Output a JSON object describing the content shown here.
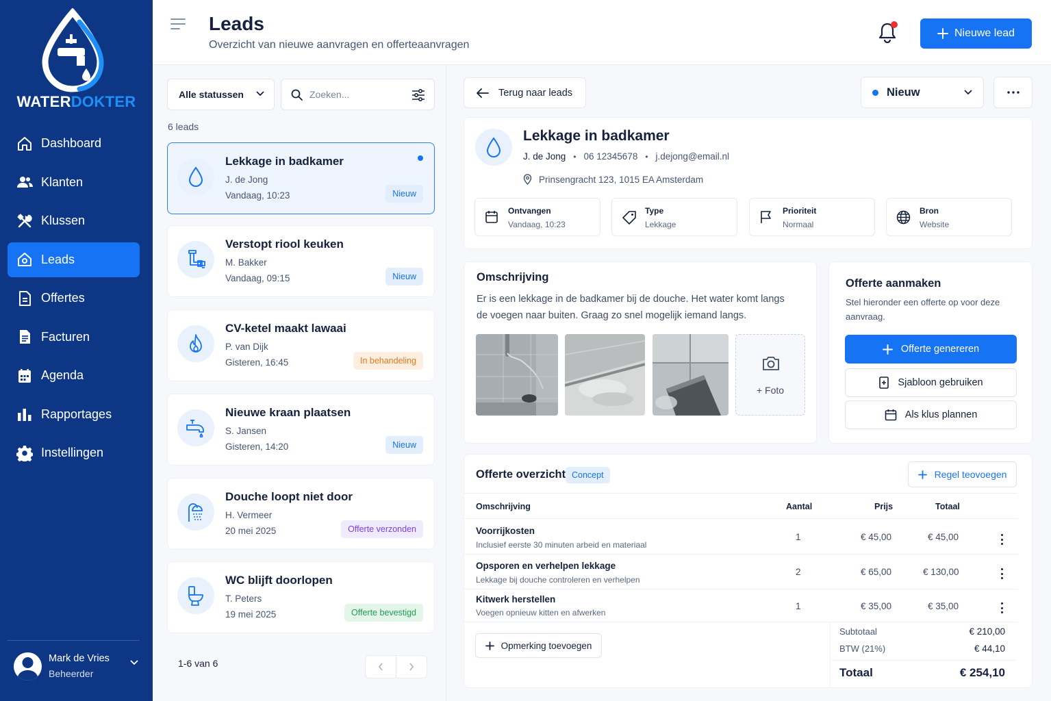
{
  "brand": {
    "word_a": "WATER",
    "word_b": "DOKTER"
  },
  "nav": {
    "items": [
      {
        "label": "Dashboard",
        "icon": "home-icon"
      },
      {
        "label": "Klanten",
        "icon": "users-icon"
      },
      {
        "label": "Klussen",
        "icon": "tools-icon"
      },
      {
        "label": "Leads",
        "icon": "inbox-icon",
        "active": true
      },
      {
        "label": "Offertes",
        "icon": "document-icon"
      },
      {
        "label": "Facturen",
        "icon": "invoice-icon"
      },
      {
        "label": "Agenda",
        "icon": "calendar-icon"
      },
      {
        "label": "Rapportages",
        "icon": "bar-chart-icon"
      },
      {
        "label": "Instellingen",
        "icon": "gear-icon"
      }
    ]
  },
  "user": {
    "name": "Mark de Vries",
    "role": "Beheerder"
  },
  "header": {
    "title": "Leads",
    "subtitle": "Overzicht van nieuwe aanvragen en offerteaanvragen",
    "new_lead_label": "Nieuwe lead"
  },
  "list": {
    "status_filter": "Alle statussen",
    "search_placeholder": "Zoeken...",
    "count_label": "6 leads",
    "pagination_label": "1-6 van 6",
    "items": [
      {
        "title": "Lekkage in badkamer",
        "name": "J. de Jong",
        "time": "Vandaag, 10:23",
        "badge": "Nieuw",
        "badge_color": "blue",
        "icon": "water-drop-icon",
        "selected": true,
        "unread": true
      },
      {
        "title": "Verstopt riool keuken",
        "name": "M. Bakker",
        "time": "Vandaag, 09:15",
        "badge": "Nieuw",
        "badge_color": "blue",
        "icon": "pipe-icon"
      },
      {
        "title": "CV-ketel maakt lawaai",
        "name": "P. van Dijk",
        "time": "Gisteren, 16:45",
        "badge": "In behandeling",
        "badge_color": "orange",
        "icon": "flame-icon"
      },
      {
        "title": "Nieuwe kraan plaatsen",
        "name": "S. Jansen",
        "time": "Gisteren, 14:20",
        "badge": "Nieuw",
        "badge_color": "blue",
        "icon": "faucet-icon"
      },
      {
        "title": "Douche loopt niet door",
        "name": "H. Vermeer",
        "time": "20 mei 2025",
        "badge": "Offerte verzonden",
        "badge_color": "purple",
        "icon": "shower-icon"
      },
      {
        "title": "WC blijft doorlopen",
        "name": "T. Peters",
        "time": "19 mei 2025",
        "badge": "Offerte bevestigd",
        "badge_color": "green",
        "icon": "toilet-icon"
      }
    ]
  },
  "detail": {
    "back_label": "Terug naar leads",
    "status": "Nieuw",
    "title": "Lekkage in badkamer",
    "contact_name": "J. de Jong",
    "phone": "06 12345678",
    "email": "j.dejong@email.nl",
    "address": "Prinsengracht 123, 1015 EA Amsterdam",
    "meta": [
      {
        "label": "Ontvangen",
        "value": "Vandaag, 10:23",
        "icon": "calendar-icon"
      },
      {
        "label": "Type",
        "value": "Lekkage",
        "icon": "tag-icon"
      },
      {
        "label": "Prioriteit",
        "value": "Normaal",
        "icon": "flag-icon"
      },
      {
        "label": "Bron",
        "value": "Website",
        "icon": "globe-icon"
      }
    ],
    "description_title": "Omschrijving",
    "description": "Er is een lekkage in de badkamer bij de douche. Het water komt langs de voegen naar buiten. Graag zo snel mogelijk iemand langs.",
    "add_photo_label": "+ Foto"
  },
  "quote_create": {
    "title": "Offerte aanmaken",
    "description": "Stel hieronder een offerte op voor deze aanvraag.",
    "generate_label": "Offerte genereren",
    "template_label": "Sjabloon gebruiken",
    "plan_label": "Als klus plannen"
  },
  "quote": {
    "title": "Offerte overzicht",
    "status": "Concept",
    "add_row_label": "Regel teovoegen",
    "columns": [
      "Omschrijving",
      "Aantal",
      "Prijs",
      "Totaal"
    ],
    "rows": [
      {
        "title": "Voorrijkosten",
        "sub": "Inclusief eerste 30 minuten arbeid en materiaal",
        "qty": "1",
        "price": "€ 45,00",
        "total": "€ 45,00"
      },
      {
        "title": "Opsporen en verhelpen lekkage",
        "sub": "Lekkage bij douche controleren en verhelpen",
        "qty": "2",
        "price": "€ 65,00",
        "total": "€ 130,00"
      },
      {
        "title": "Kitwerk herstellen",
        "sub": "Voegen opnieuw kitten en afwerken",
        "qty": "1",
        "price": "€ 35,00",
        "total": "€ 35,00"
      }
    ],
    "note_label": "Opmerking toevoegen",
    "subtotal_label": "Subtotaal",
    "subtotal": "€ 210,00",
    "vat_label": "BTW (21%)",
    "vat": "€ 44,10",
    "total_label": "Totaal",
    "total": "€ 254,10"
  }
}
